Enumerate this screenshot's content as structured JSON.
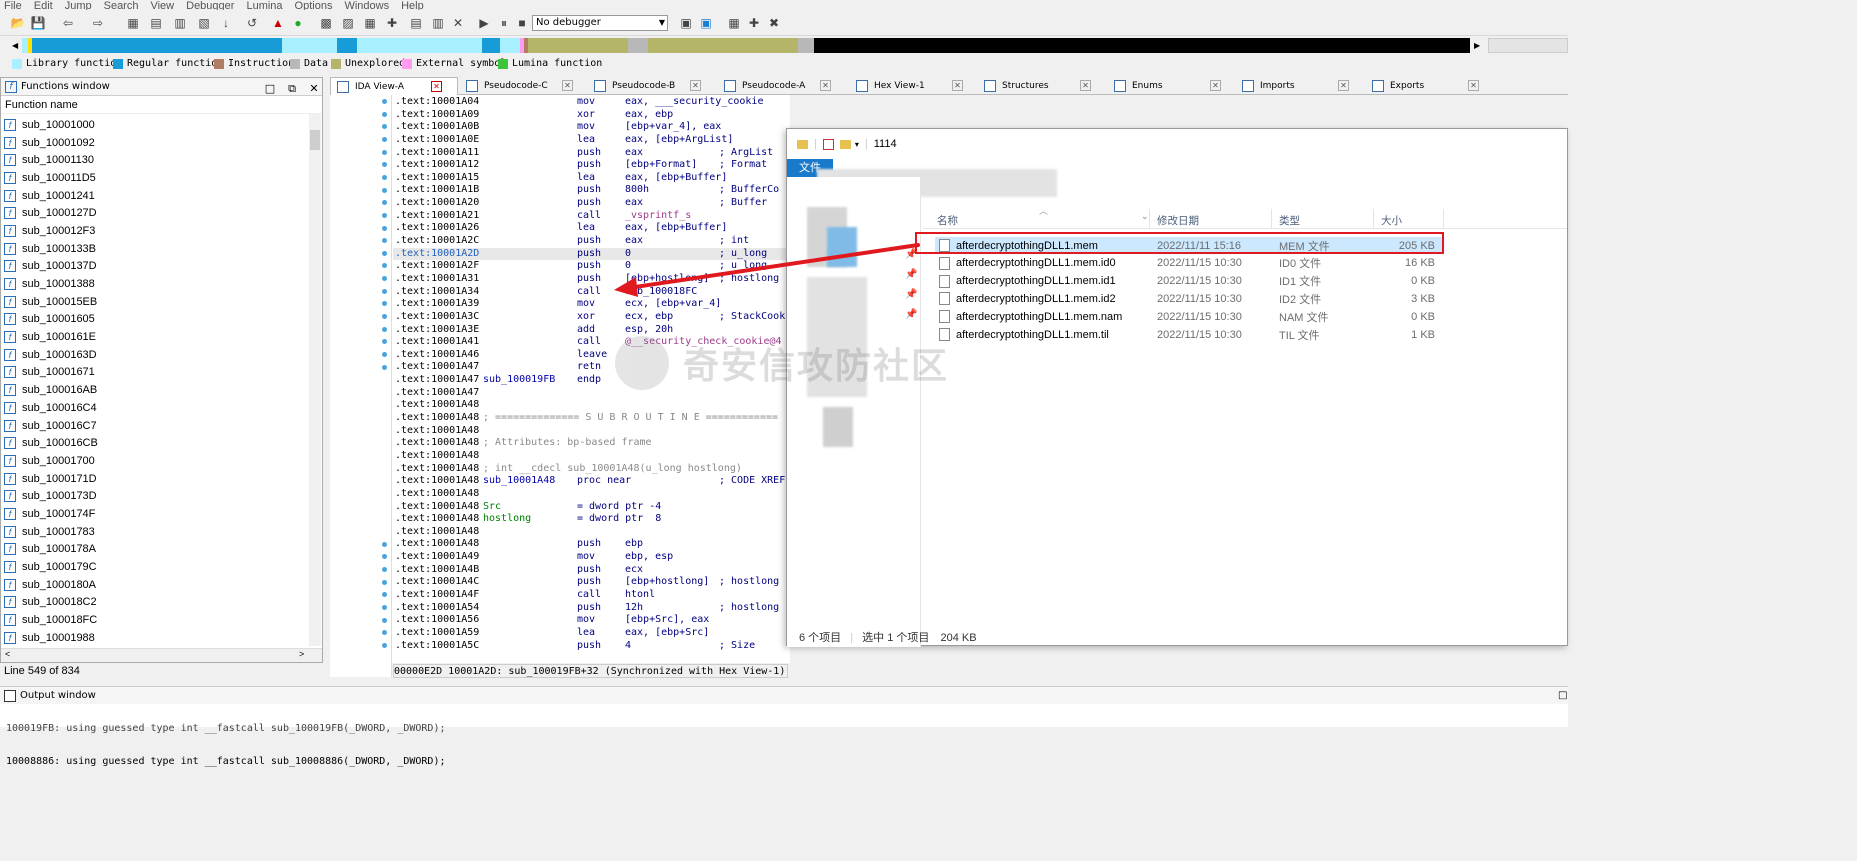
{
  "menu": [
    "File",
    "Edit",
    "Jump",
    "Search",
    "View",
    "Debugger",
    "Lumina",
    "Options",
    "Windows",
    "Help"
  ],
  "toolbar": {
    "debugger_select": "No debugger"
  },
  "legend": [
    {
      "label": "Library function",
      "color": "#a8f0ff"
    },
    {
      "label": "Regular function",
      "color": "#189cd8"
    },
    {
      "label": "Instruction",
      "color": "#b07d62"
    },
    {
      "label": "Data",
      "color": "#b8b8b8"
    },
    {
      "label": "Unexplored",
      "color": "#b5b56a"
    },
    {
      "label": "External symbol",
      "color": "#ff9cf0"
    },
    {
      "label": "Lumina function",
      "color": "#3cc43c"
    }
  ],
  "functions_window": {
    "title": "Functions window",
    "column": "Function name",
    "items": [
      "sub_10001000",
      "sub_10001092",
      "sub_10001130",
      "sub_100011D5",
      "sub_10001241",
      "sub_1000127D",
      "sub_100012F3",
      "sub_1000133B",
      "sub_1000137D",
      "sub_10001388",
      "sub_100015EB",
      "sub_10001605",
      "sub_1000161E",
      "sub_1000163D",
      "sub_10001671",
      "sub_100016AB",
      "sub_100016C4",
      "sub_100016C7",
      "sub_100016CB",
      "sub_10001700",
      "sub_1000171D",
      "sub_1000173D",
      "sub_1000174F",
      "sub_10001783",
      "sub_1000178A",
      "sub_1000179C",
      "sub_1000180A",
      "sub_100018C2",
      "sub_100018FC",
      "sub_10001988"
    ],
    "status": "Line 549 of 834"
  },
  "tabs": [
    {
      "label": "IDA View-A",
      "active": true
    },
    {
      "label": "Pseudocode-C"
    },
    {
      "label": "Pseudocode-B"
    },
    {
      "label": "Pseudocode-A"
    },
    {
      "label": "Hex View-1"
    },
    {
      "label": "Structures"
    },
    {
      "label": "Enums"
    },
    {
      "label": "Imports"
    },
    {
      "label": "Exports"
    }
  ],
  "code_lines": [
    {
      "addr": ".text:10001A04",
      "mn": "mov",
      "op": "eax, ___security_cookie"
    },
    {
      "addr": ".text:10001A09",
      "mn": "xor",
      "op": "eax, ebp"
    },
    {
      "addr": ".text:10001A0B",
      "mn": "mov",
      "op": "[ebp+var_4], eax"
    },
    {
      "addr": ".text:10001A0E",
      "mn": "lea",
      "op": "eax, [ebp+ArgList]"
    },
    {
      "addr": ".text:10001A11",
      "mn": "push",
      "op": "eax",
      "cm": "; ArgList"
    },
    {
      "addr": ".text:10001A12",
      "mn": "push",
      "op": "[ebp+Format]",
      "cm": "; Format"
    },
    {
      "addr": ".text:10001A15",
      "mn": "lea",
      "op": "eax, [ebp+Buffer]"
    },
    {
      "addr": ".text:10001A1B",
      "mn": "push",
      "op": "800h",
      "cm": "; BufferCo"
    },
    {
      "addr": ".text:10001A20",
      "mn": "push",
      "op": "eax",
      "cm": "; Buffer"
    },
    {
      "addr": ".text:10001A21",
      "mn": "call",
      "op": "_vsprintf_s",
      "op_style": "pink"
    },
    {
      "addr": ".text:10001A26",
      "mn": "lea",
      "op": "eax, [ebp+Buffer]"
    },
    {
      "addr": ".text:10001A2C",
      "mn": "push",
      "op": "eax",
      "cm": "; int"
    },
    {
      "addr": ".text:10001A2D",
      "mn": "push",
      "op": "0",
      "cm": "; u_long",
      "hl": true
    },
    {
      "addr": ".text:10001A2F",
      "mn": "push",
      "op": "0",
      "cm": "; u_long"
    },
    {
      "addr": ".text:10001A31",
      "mn": "push",
      "op": "[ebp+hostlong]",
      "cm": "; hostlong"
    },
    {
      "addr": ".text:10001A34",
      "mn": "call",
      "op": "sub_100018FC"
    },
    {
      "addr": ".text:10001A39",
      "mn": "mov",
      "op": "ecx, [ebp+var_4]"
    },
    {
      "addr": ".text:10001A3C",
      "mn": "xor",
      "op": "ecx, ebp",
      "cm": "; StackCook"
    },
    {
      "addr": ".text:10001A3E",
      "mn": "add",
      "op": "esp, 20h"
    },
    {
      "addr": ".text:10001A41",
      "mn": "call",
      "op": "@__security_check_cookie@4",
      "op_style": "pink"
    },
    {
      "addr": ".text:10001A46",
      "mn": "leave",
      "op": ""
    },
    {
      "addr": ".text:10001A47",
      "mn": "retn",
      "op": ""
    },
    {
      "addr": ".text:10001A47",
      "lbl": "sub_100019FB",
      "mn": "endp",
      "op": ""
    },
    {
      "addr": ".text:10001A47"
    },
    {
      "addr": ".text:10001A48"
    },
    {
      "addr": ".text:10001A48",
      "raw": "; ============== S U B R O U T I N E ============"
    },
    {
      "addr": ".text:10001A48"
    },
    {
      "addr": ".text:10001A48",
      "raw": "; Attributes: bp-based frame"
    },
    {
      "addr": ".text:10001A48"
    },
    {
      "addr": ".text:10001A48",
      "raw": "; int __cdecl sub_10001A48(u_long hostlong)"
    },
    {
      "addr": ".text:10001A48",
      "lbl": "sub_10001A48",
      "mn": "proc near",
      "op": "",
      "cm": "; CODE XREF"
    },
    {
      "addr": ".text:10001A48"
    },
    {
      "addr": ".text:10001A48",
      "lbl": "Src",
      "lbl_style": "green",
      "mn": "= dword ptr -4",
      "op": ""
    },
    {
      "addr": ".text:10001A48",
      "lbl": "hostlong",
      "lbl_style": "green",
      "mn": "= dword ptr  8",
      "op": ""
    },
    {
      "addr": ".text:10001A48"
    },
    {
      "addr": ".text:10001A48",
      "mn": "push",
      "op": "ebp"
    },
    {
      "addr": ".text:10001A49",
      "mn": "mov",
      "op": "ebp, esp"
    },
    {
      "addr": ".text:10001A4B",
      "mn": "push",
      "op": "ecx"
    },
    {
      "addr": ".text:10001A4C",
      "mn": "push",
      "op": "[ebp+hostlong]",
      "cm": "; hostlong"
    },
    {
      "addr": ".text:10001A4F",
      "mn": "call",
      "op": "htonl"
    },
    {
      "addr": ".text:10001A54",
      "mn": "push",
      "op": "12h",
      "cm": "; hostlong"
    },
    {
      "addr": ".text:10001A56",
      "mn": "mov",
      "op": "[ebp+Src], eax"
    },
    {
      "addr": ".text:10001A59",
      "mn": "lea",
      "op": "eax, [ebp+Src]"
    },
    {
      "addr": ".text:10001A5C",
      "mn": "push",
      "op": "4",
      "cm": "; Size"
    }
  ],
  "ida_status": "00000E2D 10001A2D: sub_100019FB+32 (Synchronized with Hex View-1)",
  "output_window": {
    "title": "Output window",
    "lines": [
      "100019FB: using guessed type int __fastcall sub_100019FB(_DWORD, _DWORD);",
      "10008886: using guessed type int __fastcall sub_10008886(_DWORD, _DWORD);"
    ]
  },
  "explorer": {
    "path": "1114",
    "ribbon_file": "文件",
    "columns": {
      "name": "名称",
      "date": "修改日期",
      "type": "类型",
      "size": "大小"
    },
    "files": [
      {
        "name": "afterdecryptothingDLL1.mem",
        "date": "2022/11/11 15:16",
        "type": "MEM 文件",
        "size": "205 KB",
        "selected": true
      },
      {
        "name": "afterdecryptothingDLL1.mem.id0",
        "date": "2022/11/15 10:30",
        "type": "ID0 文件",
        "size": "16 KB"
      },
      {
        "name": "afterdecryptothingDLL1.mem.id1",
        "date": "2022/11/15 10:30",
        "type": "ID1 文件",
        "size": "0 KB"
      },
      {
        "name": "afterdecryptothingDLL1.mem.id2",
        "date": "2022/11/15 10:30",
        "type": "ID2 文件",
        "size": "3 KB"
      },
      {
        "name": "afterdecryptothingDLL1.mem.nam",
        "date": "2022/11/15 10:30",
        "type": "NAM 文件",
        "size": "0 KB"
      },
      {
        "name": "afterdecryptothingDLL1.mem.til",
        "date": "2022/11/15 10:30",
        "type": "TIL 文件",
        "size": "1 KB"
      }
    ],
    "status_count": "6 个项目",
    "status_selected": "选中 1 个项目",
    "status_size": "204 KB"
  },
  "watermark": "奇安信攻防社区"
}
